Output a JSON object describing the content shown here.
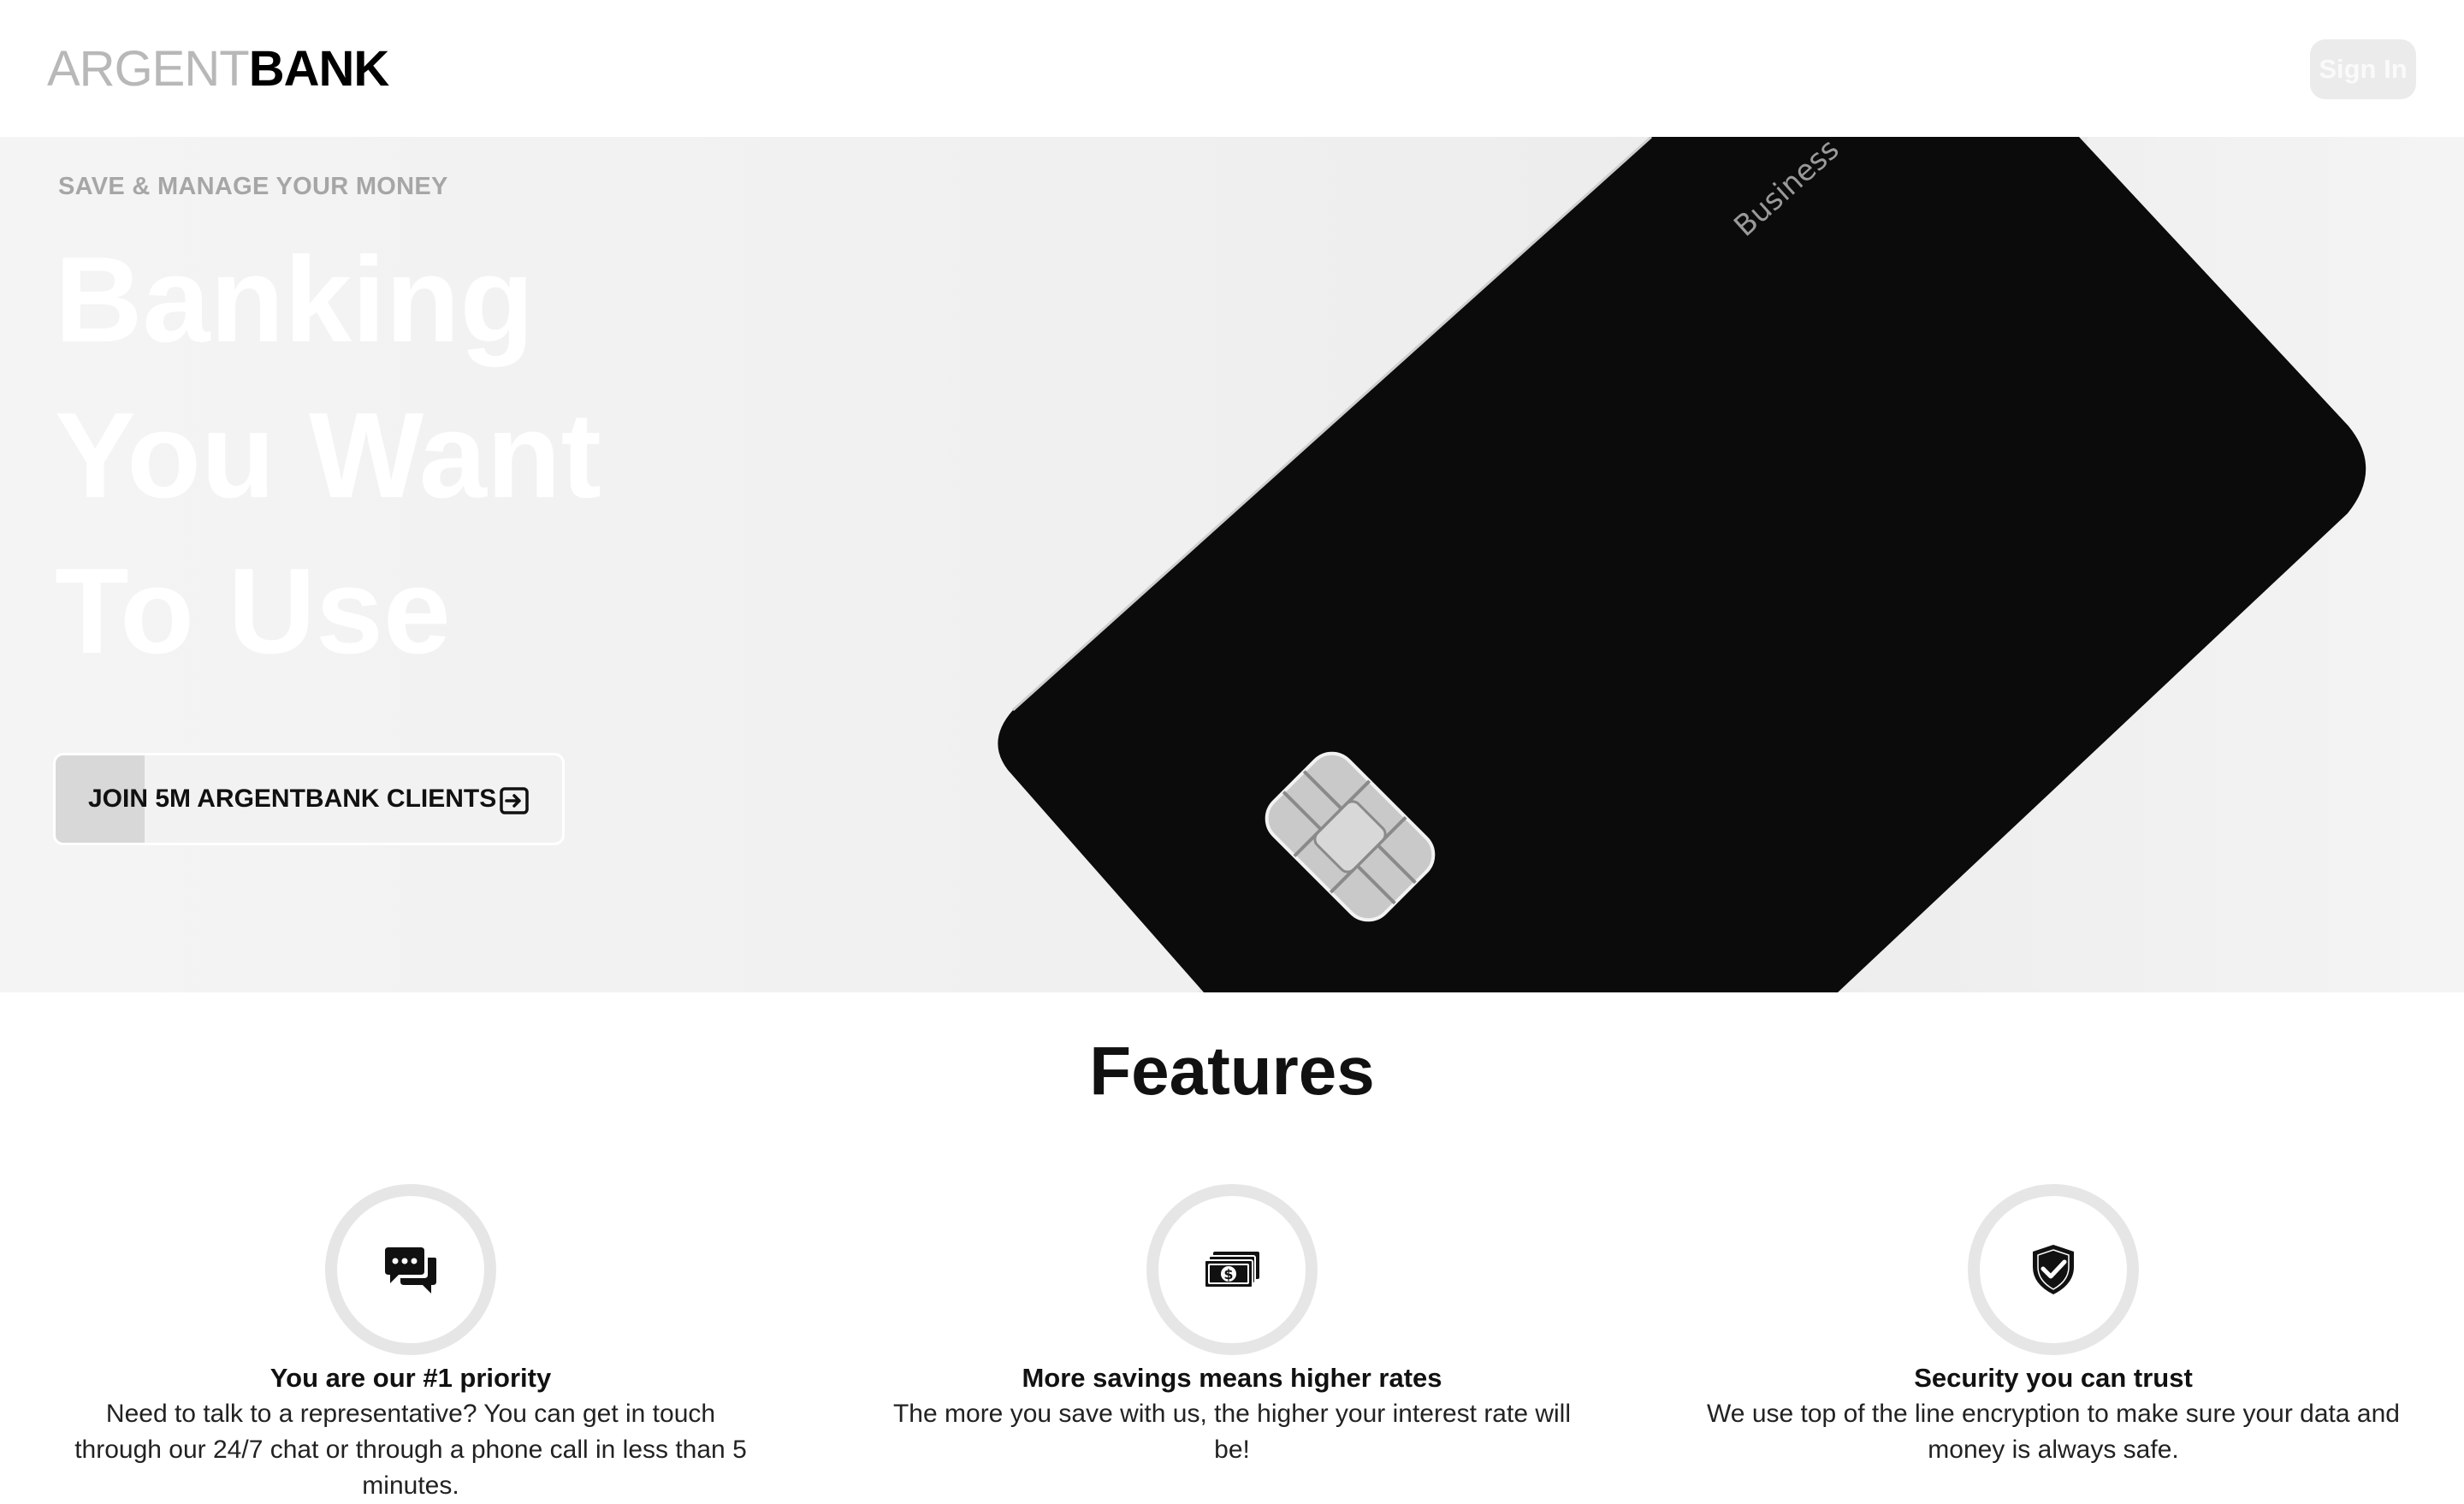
{
  "header": {
    "logo_light": "ARGENT",
    "logo_dark": "BANK",
    "sign_in_label": "Sign In"
  },
  "hero": {
    "subtitle": "SAVE & MANAGE YOUR MONEY",
    "title_lines": [
      "Banking",
      "You Want",
      "To Use"
    ],
    "card_label": "Business",
    "cta_label": "JOIN 5M ARGENTBANK CLIENTS",
    "cta_icon": "arrow-right-square-icon"
  },
  "features": {
    "title": "Features",
    "items": [
      {
        "icon": "chat-bubbles-icon",
        "heading": "You are our #1 priority",
        "text": "Need to talk to a representative? You can get in touch through our 24/7 chat or through a phone call in less than 5 minutes."
      },
      {
        "icon": "money-bills-icon",
        "heading": "More savings means higher rates",
        "text": "The more you save with us, the higher your interest rate will be!"
      },
      {
        "icon": "shield-check-icon",
        "heading": "Security you can trust",
        "text": "We use top of the line encryption to make sure your data and money is always safe."
      }
    ]
  },
  "colors": {
    "logo_light": "#b8b8b8",
    "hero_title": "#ffffff",
    "card": "#0b0b0b",
    "icon_ring": "#e6e6e6"
  }
}
